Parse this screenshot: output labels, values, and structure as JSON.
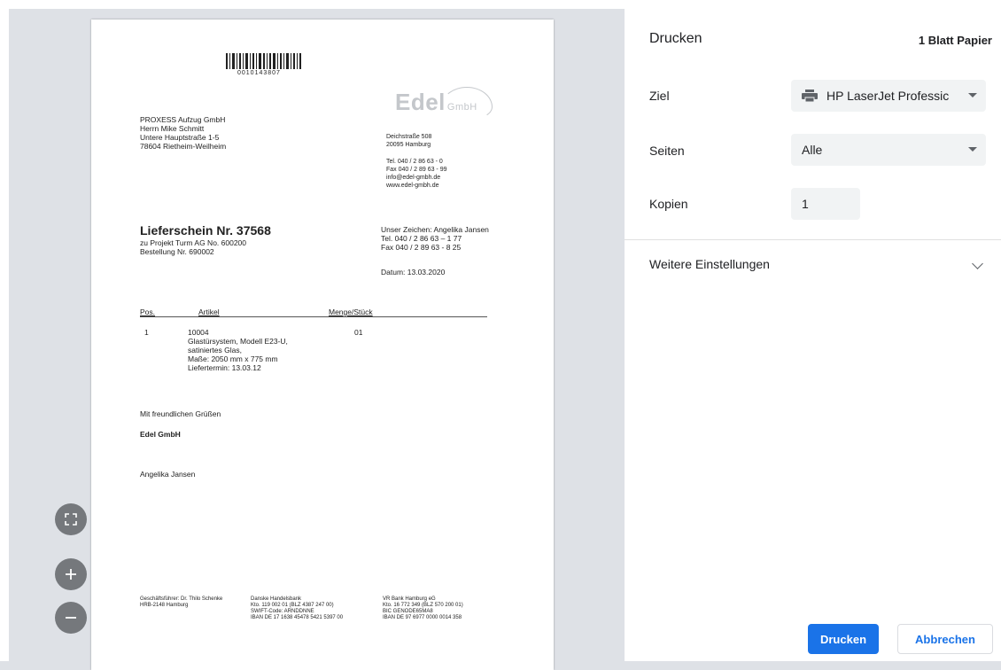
{
  "dialog": {
    "title": "Drucken",
    "sheets": "1 Blatt Papier",
    "destination_label": "Ziel",
    "destination_value": "HP LaserJet Professic",
    "pages_label": "Seiten",
    "pages_value": "Alle",
    "copies_label": "Kopien",
    "copies_value": "1",
    "more_settings": "Weitere Einstellungen",
    "print_button": "Drucken",
    "cancel_button": "Abbrechen"
  },
  "document": {
    "barcode_number": "0010143807",
    "logo_text": "Edel",
    "logo_suffix": "GmbH",
    "recipient": [
      "PROXESS Aufzug GmbH",
      "Herrn Mike Schmitt",
      "Untere Hauptstraße 1-5",
      "78604 Rietheim-Weilheim"
    ],
    "sender_address": [
      "Deichstraße 508",
      "20095 Hamburg"
    ],
    "sender_contact": [
      "Tel. 040 / 2 86 63 - 0",
      "Fax 040 / 2 89 63 - 99",
      "info@edel-gmbh.de",
      "www.edel-gmbh.de"
    ],
    "doc_title": "Lieferschein Nr. 37568",
    "doc_sub": [
      "zu Projekt Turm AG No. 600200",
      "Bestellung Nr. 690002"
    ],
    "reference": [
      "Unser Zeichen: Angelika Jansen",
      "Tel. 040 / 2 86 63 – 1 77",
      "Fax 040 / 2 89 63 - 8 25"
    ],
    "date": "Datum: 13.03.2020",
    "table_headers": [
      "Pos.",
      "Artikel",
      "Menge/Stück"
    ],
    "item_pos": "1",
    "item_lines": [
      "10004",
      "Glastürsystem, Modell E23-U,",
      "satiniertes Glas,",
      "Maße: 2050 mm x 775 mm",
      "Liefertermin: 13.03.12"
    ],
    "item_qty": "01",
    "greeting": "Mit freundlichen Grüßen",
    "company": "Edel GmbH",
    "signatory": "Angelika Jansen",
    "footer_col1": [
      "Geschäftsführer: Dr. Thilo Schenke",
      "HRB-2148 Hamburg"
    ],
    "footer_col2": [
      "Danske Handelsbank",
      "Kto. 119 002 01 (BLZ 4387 247 00)",
      "SWIFT-Code: ARNDDNNE",
      "IBAN DE 17 1638 45478 5421 5397 00"
    ],
    "footer_col3": [
      "VR Bank Hamburg eG",
      "Kto. 16 772 349 (BLZ 570 200 01)",
      "BIC GENODE65MA8",
      "IBAN DE 97 6977 0000 0014 358"
    ]
  },
  "zoom": {
    "fit_icon": "fit-to-page-icon",
    "zoom_in_icon": "zoom-in-icon",
    "zoom_out_icon": "zoom-out-icon"
  },
  "colors": {
    "accent": "#1a73e8",
    "preview_bg": "#dee1e6"
  }
}
